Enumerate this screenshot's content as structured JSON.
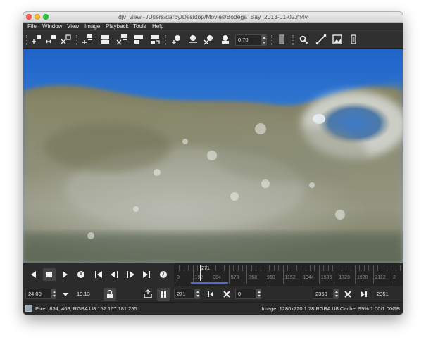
{
  "window": {
    "title": "djv_view - /Users/darby/Desktop/Movies/Bodega_Bay_2013-01-02.m4v"
  },
  "menu": [
    "File",
    "Window",
    "View",
    "Image",
    "Playback",
    "Tools",
    "Help"
  ],
  "toolbar": {
    "zoom_value": "0.70",
    "icons": [
      "window-new-icon",
      "window-copy-icon",
      "window-close-icon",
      "view-left-icon",
      "view-right-icon",
      "view-up-icon",
      "view-down-icon",
      "view-center-icon",
      "zoom-in-icon",
      "zoom-out-icon",
      "zoom-reset-icon",
      "zoom-fit-icon",
      "color-picker-icon",
      "magnify-icon",
      "ruler-icon",
      "histogram-icon",
      "info-icon"
    ]
  },
  "timeline": {
    "current_frame": "271",
    "ticks": [
      "0",
      "192",
      "384",
      "576",
      "768",
      "960",
      "1152",
      "1344",
      "1536",
      "1728",
      "1920",
      "2112",
      "2"
    ],
    "in_out_fraction": [
      0.0,
      0.163
    ]
  },
  "controls": {
    "fps": "24.00",
    "actual_fps": "19.13",
    "frame": "271",
    "in_point": "0",
    "out_point": "2350",
    "duration": "2351"
  },
  "status": {
    "pixel": "Pixel: 834, 468, RGBA U8 152 167 181 255",
    "image": "Image: 1280x720:1.78 RGBA U8  Cache: 99% 1.00/1.00GB",
    "swatch_color": "#98a7b5"
  }
}
